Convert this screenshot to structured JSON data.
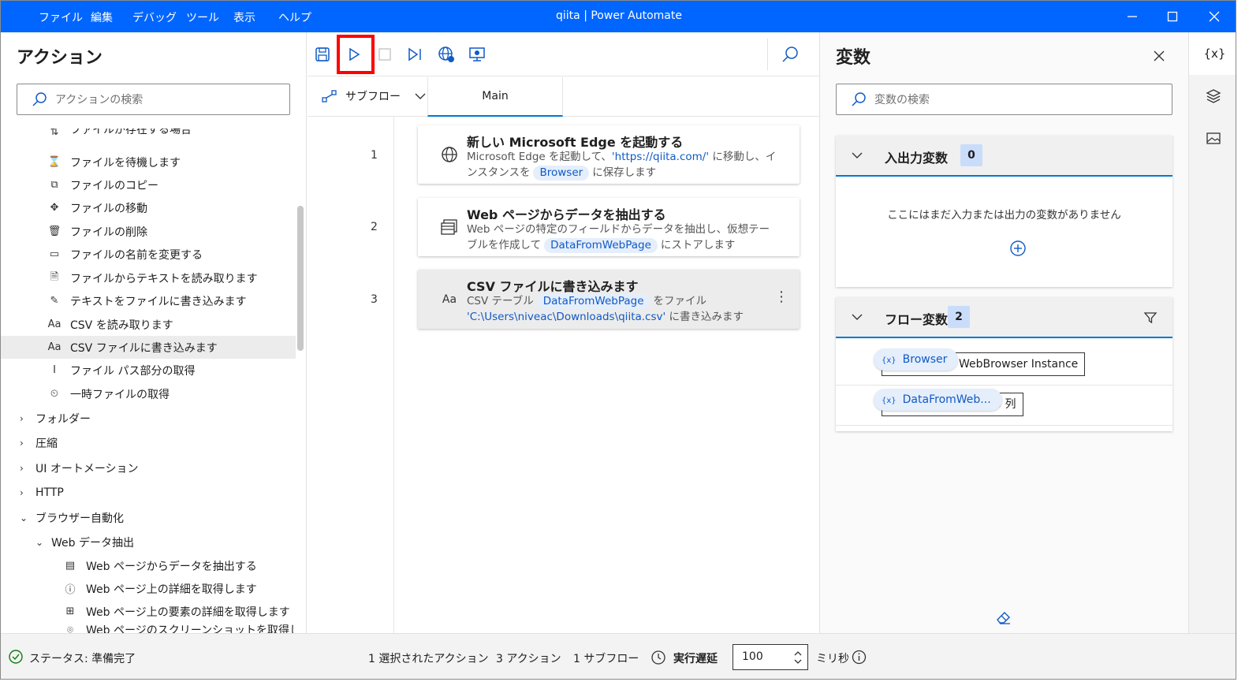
{
  "window": {
    "title": "qiita | Power Automate",
    "menu": [
      "ファイル",
      "編集",
      "デバッグ",
      "ツール",
      "表示",
      "ヘルプ"
    ]
  },
  "actions_panel": {
    "heading": "アクション",
    "search_placeholder": "アクションの検索",
    "items": [
      {
        "label": "ファイルが存在する場合",
        "icon": "file-exists-icon"
      },
      {
        "label": "ファイルを待機します",
        "icon": "hourglass-icon"
      },
      {
        "label": "ファイルのコピー",
        "icon": "copy-icon"
      },
      {
        "label": "ファイルの移動",
        "icon": "move-icon"
      },
      {
        "label": "ファイルの削除",
        "icon": "trash-icon"
      },
      {
        "label": "ファイルの名前を変更する",
        "icon": "rename-icon"
      },
      {
        "label": "ファイルからテキストを読み取ります",
        "icon": "file-read-icon"
      },
      {
        "label": "テキストをファイルに書き込みます",
        "icon": "file-write-icon"
      },
      {
        "label": "CSV を読み取ります",
        "icon": "text-aa-icon"
      },
      {
        "label": "CSV ファイルに書き込みます",
        "icon": "text-aa-icon"
      },
      {
        "label": "ファイル パス部分の取得",
        "icon": "text-cursor-icon"
      },
      {
        "label": "一時ファイルの取得",
        "icon": "temp-file-icon"
      }
    ],
    "categories": [
      "フォルダー",
      "圧縮",
      "UI オートメーション",
      "HTTP",
      "ブラウザー自動化"
    ],
    "subcategory": "Web データ抽出",
    "sub_items": [
      "Web ページからデータを抽出する",
      "Web ページ上の詳細を取得します",
      "Web ページ上の要素の詳細を取得します",
      "Web ページのスクリーンショットを取得します"
    ]
  },
  "designer": {
    "subflow_label": "サブフロー",
    "tab_main": "Main",
    "steps": [
      {
        "number": "1",
        "title": "新しい Microsoft Edge を起動する",
        "desc_a": "Microsoft Edge を起動して、",
        "link": "'https://qiita.com/'",
        "desc_b": " に移動し、インスタンスを",
        "pill": "Browser",
        "desc_c": "に保存します"
      },
      {
        "number": "2",
        "title": "Web ページからデータを抽出する",
        "desc_a": "Web ページの特定のフィールドからデータを抽出し、仮想テーブルを作成して",
        "pill": "DataFromWebPage",
        "desc_c": "にストアします"
      },
      {
        "number": "3",
        "title": "CSV ファイルに書き込みます",
        "desc_a": "CSV テーブル",
        "pill": "DataFromWebPage",
        "desc_b": "をファイル",
        "link": "'C:\\Users\\niveac\\Downloads\\qiita.csv'",
        "desc_c": " に書き込みます"
      }
    ]
  },
  "variables_panel": {
    "heading": "変数",
    "search_placeholder": "変数の検索",
    "io_section": {
      "title": "入出力変数",
      "count": "0",
      "empty_text": "ここにはまだ入力または出力の変数がありません"
    },
    "flow_section": {
      "title": "フロー変数",
      "count": "2",
      "vars": [
        {
          "name": "Browser",
          "value": "WebBrowser Instance"
        },
        {
          "name": "DataFromWeb...",
          "value": "30 行, 3 列"
        }
      ]
    },
    "rail_icons": [
      "variables-icon",
      "layers-icon",
      "images-icon"
    ],
    "rail_var_label": "{x}"
  },
  "status_bar": {
    "status": "ステータス: 準備完了",
    "selected": "1 選択されたアクション",
    "actions": "3 アクション",
    "subflows": "1 サブフロー",
    "delay_label": "実行遅延",
    "delay_value": "100",
    "unit": "ミリ秒"
  },
  "colors": {
    "titlebar": "#0066ff",
    "accent": "#0078d4",
    "pill_bg": "#e5eefb",
    "highlight_box": "#ff0000"
  }
}
